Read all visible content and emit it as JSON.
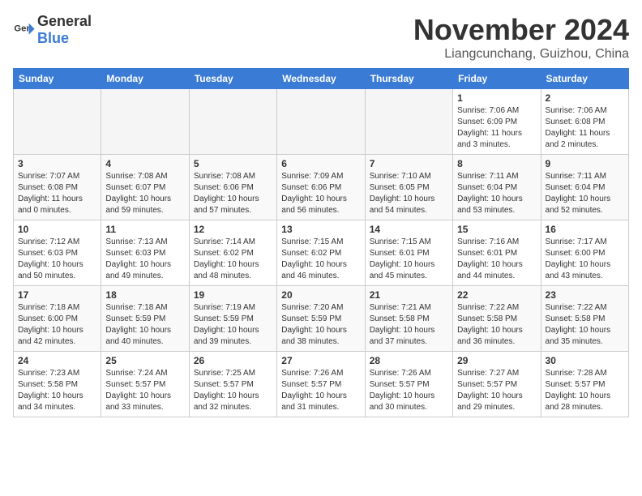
{
  "header": {
    "logo_general": "General",
    "logo_blue": "Blue",
    "month_year": "November 2024",
    "location": "Liangcunchang, Guizhou, China"
  },
  "weekdays": [
    "Sunday",
    "Monday",
    "Tuesday",
    "Wednesday",
    "Thursday",
    "Friday",
    "Saturday"
  ],
  "weeks": [
    [
      {
        "day": "",
        "empty": true
      },
      {
        "day": "",
        "empty": true
      },
      {
        "day": "",
        "empty": true
      },
      {
        "day": "",
        "empty": true
      },
      {
        "day": "",
        "empty": true
      },
      {
        "day": "1",
        "sunrise": "Sunrise: 7:06 AM",
        "sunset": "Sunset: 6:09 PM",
        "daylight": "Daylight: 11 hours and 3 minutes."
      },
      {
        "day": "2",
        "sunrise": "Sunrise: 7:06 AM",
        "sunset": "Sunset: 6:08 PM",
        "daylight": "Daylight: 11 hours and 2 minutes."
      }
    ],
    [
      {
        "day": "3",
        "sunrise": "Sunrise: 7:07 AM",
        "sunset": "Sunset: 6:08 PM",
        "daylight": "Daylight: 11 hours and 0 minutes."
      },
      {
        "day": "4",
        "sunrise": "Sunrise: 7:08 AM",
        "sunset": "Sunset: 6:07 PM",
        "daylight": "Daylight: 10 hours and 59 minutes."
      },
      {
        "day": "5",
        "sunrise": "Sunrise: 7:08 AM",
        "sunset": "Sunset: 6:06 PM",
        "daylight": "Daylight: 10 hours and 57 minutes."
      },
      {
        "day": "6",
        "sunrise": "Sunrise: 7:09 AM",
        "sunset": "Sunset: 6:06 PM",
        "daylight": "Daylight: 10 hours and 56 minutes."
      },
      {
        "day": "7",
        "sunrise": "Sunrise: 7:10 AM",
        "sunset": "Sunset: 6:05 PM",
        "daylight": "Daylight: 10 hours and 54 minutes."
      },
      {
        "day": "8",
        "sunrise": "Sunrise: 7:11 AM",
        "sunset": "Sunset: 6:04 PM",
        "daylight": "Daylight: 10 hours and 53 minutes."
      },
      {
        "day": "9",
        "sunrise": "Sunrise: 7:11 AM",
        "sunset": "Sunset: 6:04 PM",
        "daylight": "Daylight: 10 hours and 52 minutes."
      }
    ],
    [
      {
        "day": "10",
        "sunrise": "Sunrise: 7:12 AM",
        "sunset": "Sunset: 6:03 PM",
        "daylight": "Daylight: 10 hours and 50 minutes."
      },
      {
        "day": "11",
        "sunrise": "Sunrise: 7:13 AM",
        "sunset": "Sunset: 6:03 PM",
        "daylight": "Daylight: 10 hours and 49 minutes."
      },
      {
        "day": "12",
        "sunrise": "Sunrise: 7:14 AM",
        "sunset": "Sunset: 6:02 PM",
        "daylight": "Daylight: 10 hours and 48 minutes."
      },
      {
        "day": "13",
        "sunrise": "Sunrise: 7:15 AM",
        "sunset": "Sunset: 6:02 PM",
        "daylight": "Daylight: 10 hours and 46 minutes."
      },
      {
        "day": "14",
        "sunrise": "Sunrise: 7:15 AM",
        "sunset": "Sunset: 6:01 PM",
        "daylight": "Daylight: 10 hours and 45 minutes."
      },
      {
        "day": "15",
        "sunrise": "Sunrise: 7:16 AM",
        "sunset": "Sunset: 6:01 PM",
        "daylight": "Daylight: 10 hours and 44 minutes."
      },
      {
        "day": "16",
        "sunrise": "Sunrise: 7:17 AM",
        "sunset": "Sunset: 6:00 PM",
        "daylight": "Daylight: 10 hours and 43 minutes."
      }
    ],
    [
      {
        "day": "17",
        "sunrise": "Sunrise: 7:18 AM",
        "sunset": "Sunset: 6:00 PM",
        "daylight": "Daylight: 10 hours and 42 minutes."
      },
      {
        "day": "18",
        "sunrise": "Sunrise: 7:18 AM",
        "sunset": "Sunset: 5:59 PM",
        "daylight": "Daylight: 10 hours and 40 minutes."
      },
      {
        "day": "19",
        "sunrise": "Sunrise: 7:19 AM",
        "sunset": "Sunset: 5:59 PM",
        "daylight": "Daylight: 10 hours and 39 minutes."
      },
      {
        "day": "20",
        "sunrise": "Sunrise: 7:20 AM",
        "sunset": "Sunset: 5:59 PM",
        "daylight": "Daylight: 10 hours and 38 minutes."
      },
      {
        "day": "21",
        "sunrise": "Sunrise: 7:21 AM",
        "sunset": "Sunset: 5:58 PM",
        "daylight": "Daylight: 10 hours and 37 minutes."
      },
      {
        "day": "22",
        "sunrise": "Sunrise: 7:22 AM",
        "sunset": "Sunset: 5:58 PM",
        "daylight": "Daylight: 10 hours and 36 minutes."
      },
      {
        "day": "23",
        "sunrise": "Sunrise: 7:22 AM",
        "sunset": "Sunset: 5:58 PM",
        "daylight": "Daylight: 10 hours and 35 minutes."
      }
    ],
    [
      {
        "day": "24",
        "sunrise": "Sunrise: 7:23 AM",
        "sunset": "Sunset: 5:58 PM",
        "daylight": "Daylight: 10 hours and 34 minutes."
      },
      {
        "day": "25",
        "sunrise": "Sunrise: 7:24 AM",
        "sunset": "Sunset: 5:57 PM",
        "daylight": "Daylight: 10 hours and 33 minutes."
      },
      {
        "day": "26",
        "sunrise": "Sunrise: 7:25 AM",
        "sunset": "Sunset: 5:57 PM",
        "daylight": "Daylight: 10 hours and 32 minutes."
      },
      {
        "day": "27",
        "sunrise": "Sunrise: 7:26 AM",
        "sunset": "Sunset: 5:57 PM",
        "daylight": "Daylight: 10 hours and 31 minutes."
      },
      {
        "day": "28",
        "sunrise": "Sunrise: 7:26 AM",
        "sunset": "Sunset: 5:57 PM",
        "daylight": "Daylight: 10 hours and 30 minutes."
      },
      {
        "day": "29",
        "sunrise": "Sunrise: 7:27 AM",
        "sunset": "Sunset: 5:57 PM",
        "daylight": "Daylight: 10 hours and 29 minutes."
      },
      {
        "day": "30",
        "sunrise": "Sunrise: 7:28 AM",
        "sunset": "Sunset: 5:57 PM",
        "daylight": "Daylight: 10 hours and 28 minutes."
      }
    ]
  ]
}
